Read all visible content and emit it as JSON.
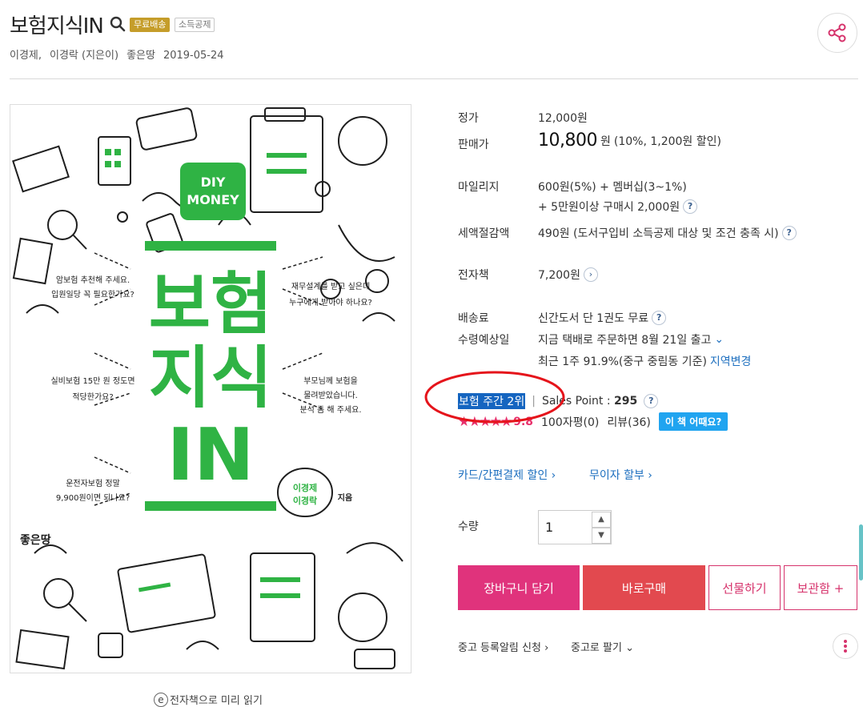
{
  "header": {
    "title": "보험지식IN",
    "badges": [
      "무료배송",
      "소득공제"
    ],
    "authors": [
      "이경제,",
      "이경락 (지은이)",
      "좋은땅",
      "2019-05-24"
    ]
  },
  "cover": {
    "diy": "DIY",
    "money": "MONEY",
    "big_title": [
      "보험",
      "지식",
      "IN"
    ],
    "quotes": [
      [
        "암보험 추천해 주세요.",
        "입원일당 꼭 필요한가요?"
      ],
      [
        "재무설계를 받고 싶은데",
        "누구에게 받아야 하나요?"
      ],
      [
        "실비보험 15만 원 정도면",
        "적당한가요?"
      ],
      [
        "부모님께 보험을",
        "물려받았습니다.",
        "분석 좀 해 주세요."
      ],
      [
        "운전자보험 정말",
        "9,900원이면 되나요?"
      ]
    ],
    "author_bubble": [
      "이경제",
      "이경락"
    ],
    "author_suffix": "지음",
    "publisher": "좋은땅"
  },
  "ebook_preview": {
    "icon": "e",
    "label": "전자책으로 미리 읽기"
  },
  "price": {
    "list_label": "정가",
    "list_value": "12,000원",
    "sale_label": "판매가",
    "sale_value": "10,800",
    "sale_unit": "원",
    "sale_detail": "(10%, 1,200원 할인)"
  },
  "mileage": {
    "label": "마일리지",
    "line1": "600원(5%) + 멤버십(3~1%)",
    "line2": "+ 5만원이상 구매시 2,000원"
  },
  "tax": {
    "label": "세액절감액",
    "value": "490원 (도서구입비 소득공제 대상 및 조건 충족 시)"
  },
  "ebook": {
    "label": "전자책",
    "value": "7,200원"
  },
  "shipping": {
    "fee_label": "배송료",
    "fee_value": "신간도서 단 1권도 무료",
    "eta_label": "수령예상일",
    "eta_value": "지금 택배로 주문하면 8월 21일 출고",
    "recent": "최근 1주 91.9%(중구 중림동 기준)",
    "region_link": "지역변경"
  },
  "rank": {
    "label": "보험 주간 2위",
    "sep": "|",
    "sales_point_label": "Sales Point : ",
    "sales_point_value": "295",
    "stars": "★★★★★",
    "rating": "9.8",
    "reviews_100": "100자평(0)",
    "reviews": "리뷰(36)",
    "how_book": "이 책 어때요?"
  },
  "links": {
    "card": "카드/간편결제 할인 ›",
    "installment": "무이자 할부 ›"
  },
  "quantity": {
    "label": "수량",
    "value": "1",
    "up": "▲",
    "down": "▼"
  },
  "buttons": {
    "cart": "장바구니 담기",
    "buy": "바로구매",
    "gift": "선물하기",
    "save": "보관함 +"
  },
  "used": {
    "notify": "중고 등록알림 신청 ›",
    "sell": "중고로 팔기 ⌄"
  },
  "icons": {
    "search": "search-icon",
    "share": "share-icon",
    "question": "?",
    "chevron": "›",
    "chevron_down": "⌄",
    "more": "more-icon"
  },
  "colors": {
    "accent_pink": "#e0337c",
    "buy_red": "#e2494f",
    "cover_green": "#2fb344",
    "link_blue": "#1d6fbf",
    "highlight_ellipse": "#e5141b"
  }
}
